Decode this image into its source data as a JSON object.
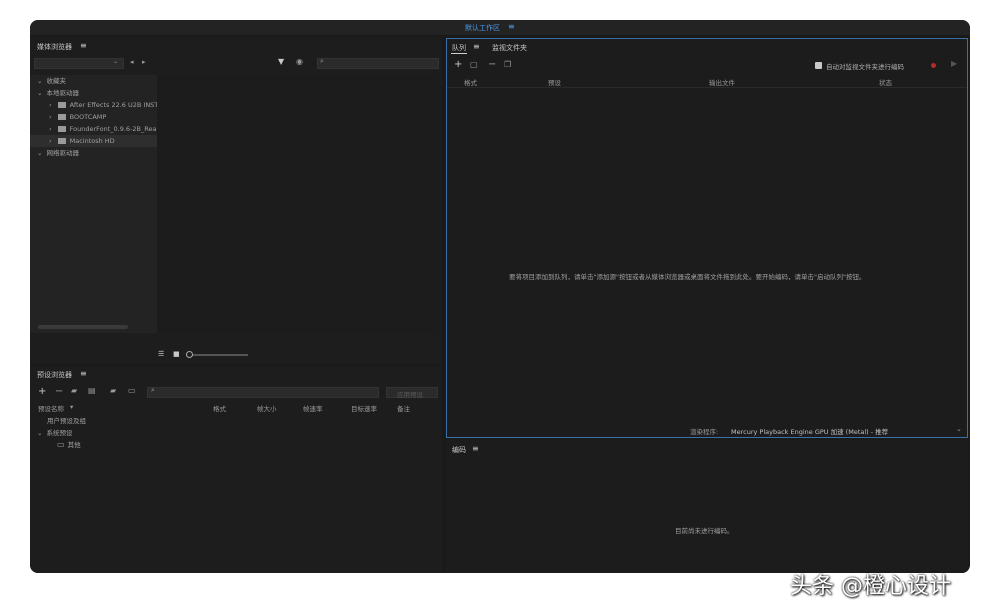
{
  "titlebar": {
    "workspace": "默认工作区",
    "menu_icon": "≡"
  },
  "media_browser": {
    "title": "媒体浏览器",
    "menu_icon": "≡",
    "tree": [
      {
        "label": "收藏夹",
        "level": 0,
        "expanded": true
      },
      {
        "label": "本地驱动器",
        "level": 0,
        "expanded": true
      },
      {
        "label": "After Effects 22.6 U2B INST",
        "level": 1
      },
      {
        "label": "BOOTCAMP",
        "level": 1
      },
      {
        "label": "FounderFont_0.9.6-2B_Rea",
        "level": 1
      },
      {
        "label": "Macintosh HD",
        "level": 1,
        "selected": true
      },
      {
        "label": "网络驱动器",
        "level": 0,
        "expanded": true
      }
    ]
  },
  "preset_browser": {
    "title": "预设浏览器",
    "menu_icon": "≡",
    "apply_button": "应用预设",
    "columns": [
      "预设名称",
      "格式",
      "帧大小",
      "帧速率",
      "目标速率",
      "备注"
    ],
    "rows": [
      {
        "label": "用户预设及组",
        "level": 1
      },
      {
        "label": "系统预设",
        "level": 0,
        "expanded": true
      },
      {
        "label": "其他",
        "level": 1
      }
    ]
  },
  "queue": {
    "tabs": [
      {
        "label": "队列",
        "active": true
      },
      {
        "label": "监视文件夹",
        "active": false
      }
    ],
    "tab_menu_icon": "≡",
    "auto_encode_label": "自动对监视文件夹进行编码",
    "auto_encode_checked": true,
    "columns": [
      "格式",
      "预设",
      "输出文件",
      "状态"
    ],
    "empty_message": "要将项目添加到队列，请单击\"添加源\"按钮或者从媒体浏览器或桌面将文件拖到此处。要开始编码，请单击\"启动队列\"按钮。",
    "renderer_label": "渲染程序:",
    "renderer_value": "Mercury Playback Engine GPU 加速 (Metal) - 推荐"
  },
  "encoding": {
    "title": "编码",
    "menu_icon": "≡",
    "empty_message": "目前尚未进行编码。"
  },
  "watermark": "头条 @橙心设计"
}
